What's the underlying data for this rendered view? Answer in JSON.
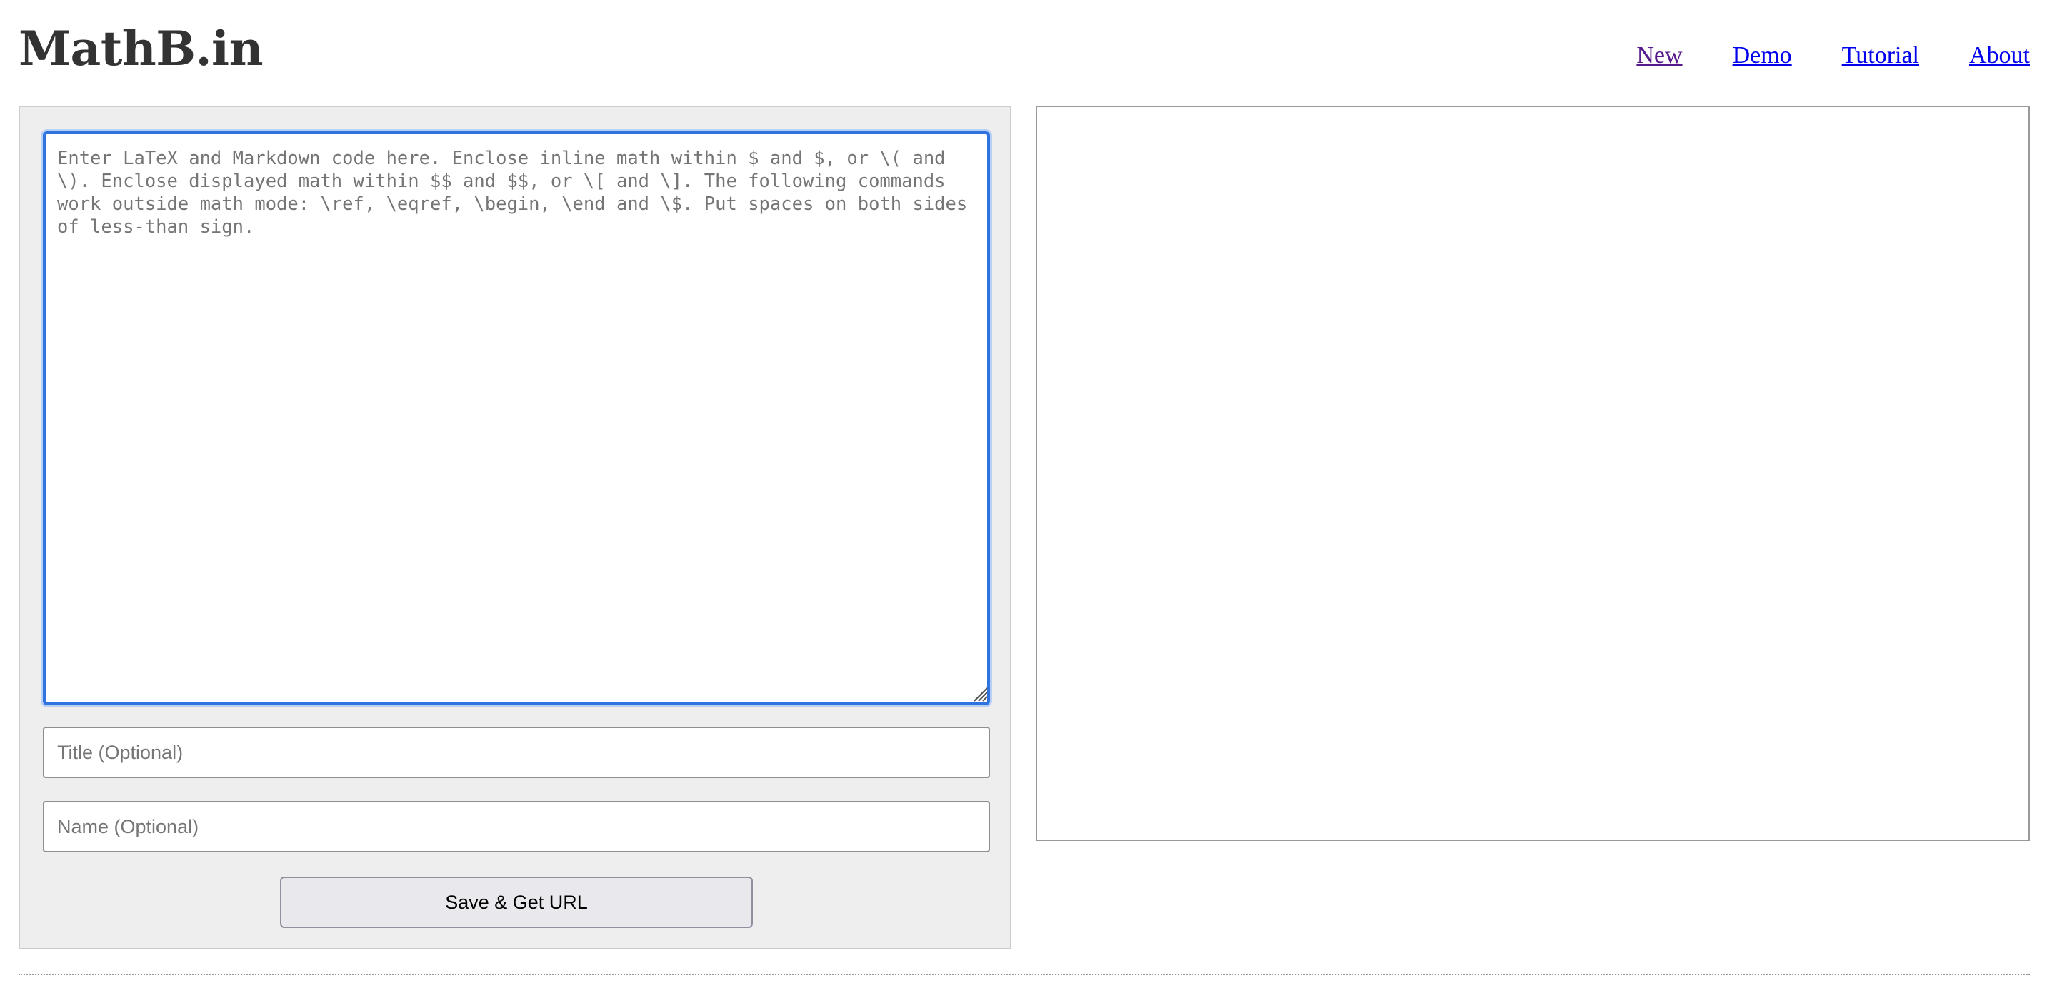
{
  "header": {
    "logo": "MathB.in"
  },
  "nav": {
    "items": [
      {
        "label": "New"
      },
      {
        "label": "Demo"
      },
      {
        "label": "Tutorial"
      },
      {
        "label": "About"
      }
    ]
  },
  "editor": {
    "code_placeholder": "Enter LaTeX and Markdown code here. Enclose inline math within $ and $, or \\( and \\). Enclose displayed math within $$ and $$, or \\[ and \\]. The following commands work outside math mode: \\ref, \\eqref, \\begin, \\end and \\$. Put spaces on both sides of less-than sign.",
    "title_placeholder": "Title (Optional)",
    "name_placeholder": "Name (Optional)",
    "save_label": "Save & Get URL"
  },
  "colors": {
    "link": "#0000ee",
    "link_visited": "#551a8b",
    "focus_border": "#2f73e0",
    "panel_bg": "#eeeeef"
  }
}
